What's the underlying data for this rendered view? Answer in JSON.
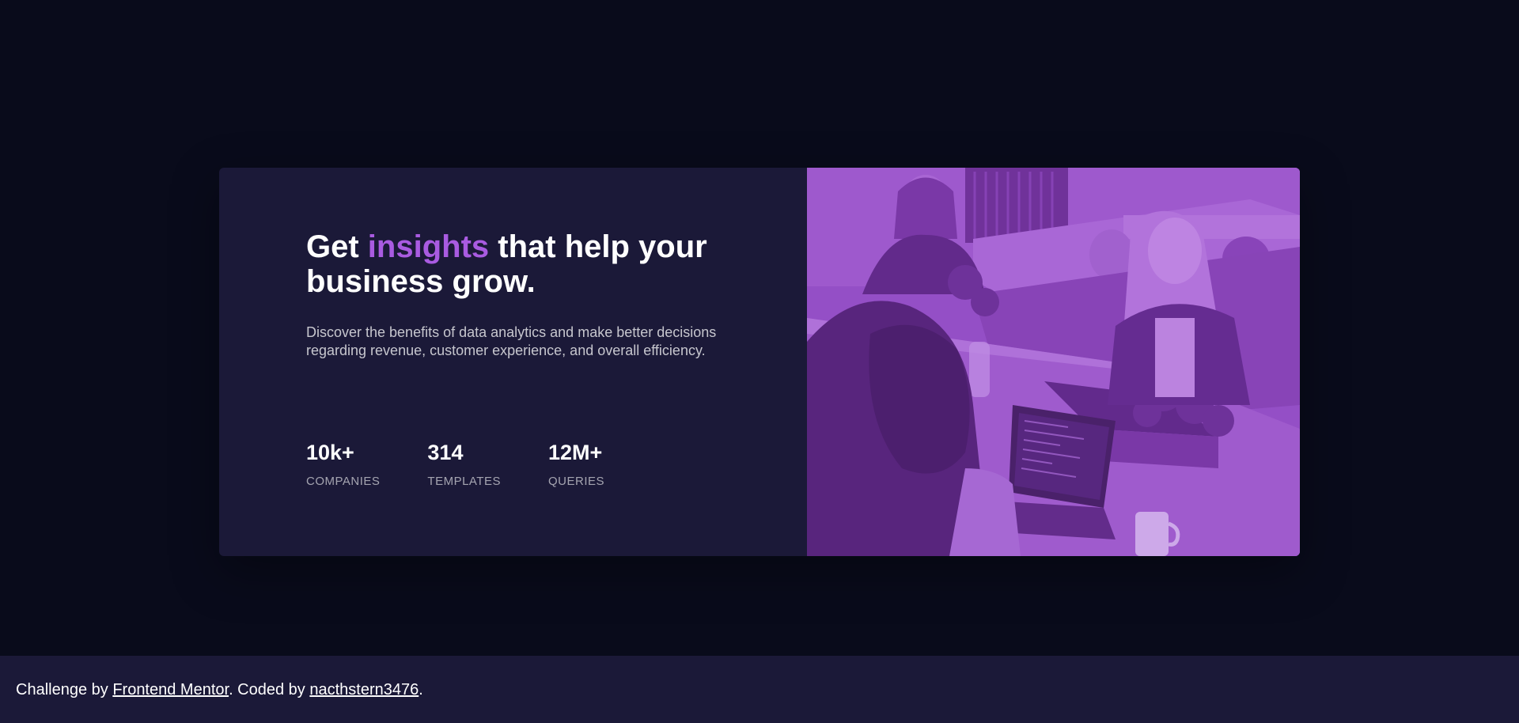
{
  "card": {
    "headline": {
      "before": "Get ",
      "accent": "insights",
      "after": " that help your business grow."
    },
    "description": "Discover the benefits of data analytics and make better decisions regarding revenue, customer experience, and overall efficiency.",
    "stats": [
      {
        "value": "10k+",
        "label": "COMPANIES"
      },
      {
        "value": "314",
        "label": "TEMPLATES"
      },
      {
        "value": "12M+",
        "label": "QUERIES"
      }
    ]
  },
  "footer": {
    "prefix": "Challenge by ",
    "link1": "Frontend Mentor",
    "middle": ". Coded by ",
    "link2": "nacthstern3476",
    "suffix": "."
  },
  "colors": {
    "page_background": "#090b1b",
    "card_background": "#1b1938",
    "accent": "#a95be1",
    "image_overlay": "#aa5cdb"
  }
}
